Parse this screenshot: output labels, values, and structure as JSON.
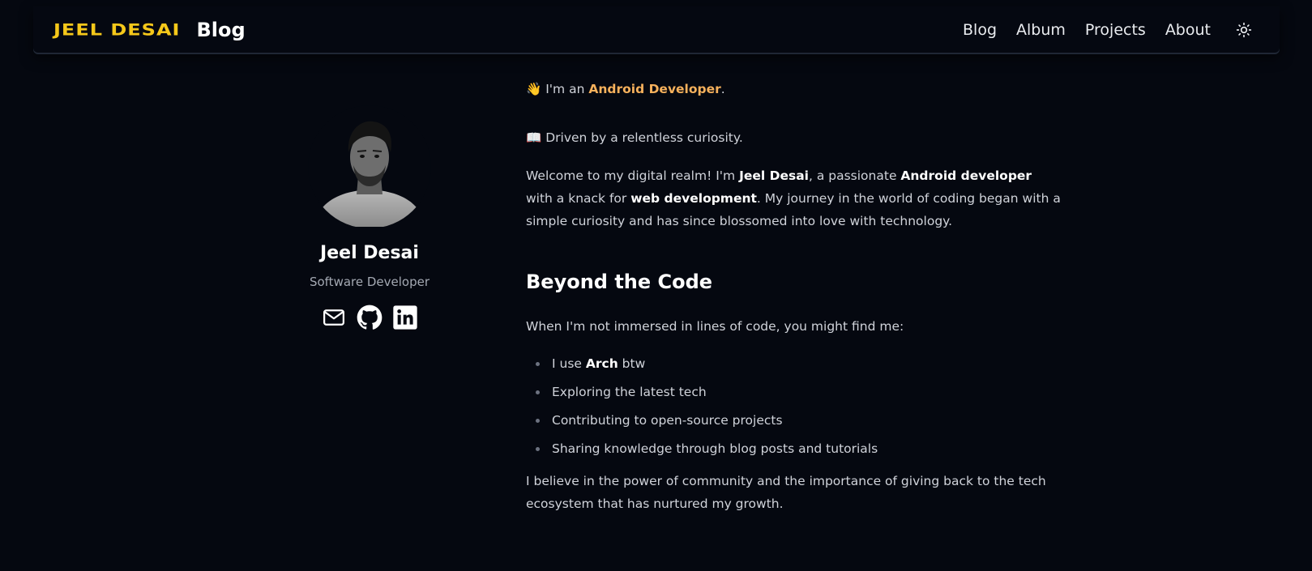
{
  "navbar": {
    "brand": "JEEL DESAI",
    "section": "Blog",
    "links": [
      "Blog",
      "Album",
      "Projects",
      "About"
    ],
    "theme_toggle_icon": "sun-icon"
  },
  "profile": {
    "avatar_alt": "Jeel Desai",
    "name": "Jeel Desai",
    "role": "Software Developer",
    "socials": [
      "mail-icon",
      "github-icon",
      "linkedin-icon"
    ]
  },
  "content": {
    "intro_line1": {
      "prefix": "👋 I'm an ",
      "highlight": "Android Developer",
      "suffix": "."
    },
    "intro_line2": "📖 Driven by a relentless curiosity.",
    "welcome": {
      "t1": "Welcome to my digital realm! I'm ",
      "b1": "Jeel Desai",
      "t2": ", a passionate ",
      "b2": "Android developer",
      "t3": " with a knack for ",
      "b3": "web development",
      "t4": ". My journey in the world of coding began with a simple curiosity and has since blossomed into love with technology."
    },
    "section_title": "Beyond the Code",
    "beyond_intro": "When I'm not immersed in lines of code, you might find me:",
    "bullet1": {
      "prefix": "I use ",
      "bold": "Arch",
      "suffix": " btw"
    },
    "bullets": [
      "Exploring the latest tech",
      "Contributing to open-source projects",
      "Sharing knowledge through blog posts and tutorials"
    ],
    "closing": "I believe in the power of community and the importance of giving back to the tech ecosystem that has nurtured my growth."
  },
  "colors": {
    "background": "#050810",
    "brand": "#f6c81a",
    "accent": "#f6b15c",
    "text": "#d0d3da"
  }
}
